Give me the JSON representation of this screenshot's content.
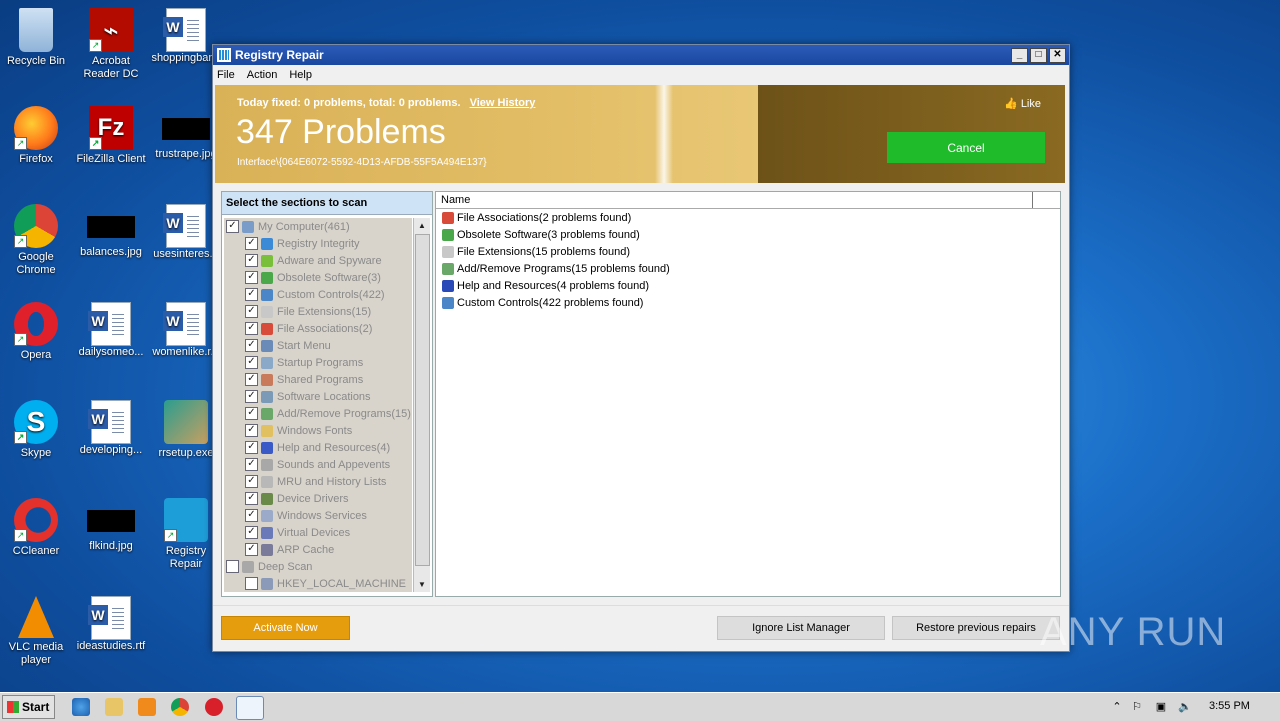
{
  "desktop": {
    "icons": [
      {
        "label": "Recycle Bin"
      },
      {
        "label": "Acrobat Reader DC"
      },
      {
        "label": "shoppingbar..."
      },
      {
        "label": "Firefox"
      },
      {
        "label": "FileZilla Client"
      },
      {
        "label": "trustrape.jpg"
      },
      {
        "label": "Google Chrome"
      },
      {
        "label": "balances.jpg"
      },
      {
        "label": "usesinteres..."
      },
      {
        "label": "Opera"
      },
      {
        "label": "dailysomeo..."
      },
      {
        "label": "womenlike.r..."
      },
      {
        "label": "Skype"
      },
      {
        "label": "developing..."
      },
      {
        "label": "rrsetup.exe"
      },
      {
        "label": "CCleaner"
      },
      {
        "label": "flkind.jpg"
      },
      {
        "label": "Registry Repair"
      },
      {
        "label": "VLC media player"
      },
      {
        "label": "ideastudies.rtf"
      }
    ]
  },
  "window": {
    "title": "Registry Repair",
    "menu": [
      "File",
      "Action",
      "Help"
    ],
    "banner": {
      "fixed_text": "Today fixed: 0 problems, total: 0 problems.",
      "view_history": "View History",
      "problems_count": "347 Problems",
      "interface_path": "Interface\\{064E6072-5592-4D13-AFDB-55F5A494E137}",
      "like": "Like",
      "cancel": "Cancel"
    },
    "left_panel": {
      "header": "Select the sections to scan",
      "tree": [
        {
          "label": "My Computer(461)",
          "level": 0,
          "checked": true,
          "icon": "computer-icon",
          "color": "#7a9cc8"
        },
        {
          "label": "Registry Integrity",
          "level": 1,
          "checked": true,
          "icon": "registry-icon",
          "color": "#3a8ad8"
        },
        {
          "label": "Adware and Spyware",
          "level": 1,
          "checked": true,
          "icon": "spyware-icon",
          "color": "#7abf3a"
        },
        {
          "label": "Obsolete Software(3)",
          "level": 1,
          "checked": true,
          "icon": "trash-icon",
          "color": "#4aa84a"
        },
        {
          "label": "Custom Controls(422)",
          "level": 1,
          "checked": true,
          "icon": "controls-icon",
          "color": "#4a86c8"
        },
        {
          "label": "File Extensions(15)",
          "level": 1,
          "checked": true,
          "icon": "file-icon",
          "color": "#c8c8c8"
        },
        {
          "label": "File Associations(2)",
          "level": 1,
          "checked": true,
          "icon": "association-icon",
          "color": "#d84a3a"
        },
        {
          "label": "Start Menu",
          "level": 1,
          "checked": true,
          "icon": "start-menu-icon",
          "color": "#6a8ab8"
        },
        {
          "label": "Startup Programs",
          "level": 1,
          "checked": true,
          "icon": "startup-icon",
          "color": "#8aa8c8"
        },
        {
          "label": "Shared Programs",
          "level": 1,
          "checked": true,
          "icon": "shared-icon",
          "color": "#c87a5a"
        },
        {
          "label": "Software Locations",
          "level": 1,
          "checked": true,
          "icon": "location-icon",
          "color": "#7a9ab8"
        },
        {
          "label": "Add/Remove Programs(15)",
          "level": 1,
          "checked": true,
          "icon": "add-remove-icon",
          "color": "#6aa86a"
        },
        {
          "label": "Windows Fonts",
          "level": 1,
          "checked": true,
          "icon": "fonts-icon",
          "color": "#e0c060"
        },
        {
          "label": "Help and Resources(4)",
          "level": 1,
          "checked": true,
          "icon": "help-icon",
          "color": "#3a5ac8"
        },
        {
          "label": "Sounds and Appevents",
          "level": 1,
          "checked": true,
          "icon": "sound-icon",
          "color": "#a8a8a8"
        },
        {
          "label": "MRU and History Lists",
          "level": 1,
          "checked": true,
          "icon": "history-icon",
          "color": "#b8b8b8"
        },
        {
          "label": "Device Drivers",
          "level": 1,
          "checked": true,
          "icon": "driver-icon",
          "color": "#6a8a4a"
        },
        {
          "label": "Windows Services",
          "level": 1,
          "checked": true,
          "icon": "services-icon",
          "color": "#9aaac8"
        },
        {
          "label": "Virtual Devices",
          "level": 1,
          "checked": true,
          "icon": "virtual-device-icon",
          "color": "#6a7ab8"
        },
        {
          "label": "ARP Cache",
          "level": 1,
          "checked": true,
          "icon": "network-icon",
          "color": "#7a7a9a"
        },
        {
          "label": "Deep Scan",
          "level": 0,
          "checked": false,
          "icon": "deep-scan-icon",
          "color": "#a8a8a8"
        },
        {
          "label": "HKEY_LOCAL_MACHINE",
          "level": 1,
          "checked": false,
          "icon": "hive-icon",
          "color": "#8a9ab8"
        }
      ]
    },
    "right_panel": {
      "column_header": "Name",
      "rows": [
        {
          "label": "File Associations(2 problems found)",
          "icon": "association-icon",
          "color": "#d84a3a"
        },
        {
          "label": "Obsolete Software(3 problems found)",
          "icon": "trash-icon",
          "color": "#4aa84a"
        },
        {
          "label": "File Extensions(15 problems found)",
          "icon": "file-icon",
          "color": "#c8c8c8"
        },
        {
          "label": "Add/Remove Programs(15 problems found)",
          "icon": "add-remove-icon",
          "color": "#6aa86a"
        },
        {
          "label": "Help and Resources(4 problems found)",
          "icon": "help-icon",
          "color": "#2a4ab8"
        },
        {
          "label": "Custom Controls(422 problems found)",
          "icon": "controls-icon",
          "color": "#4a86c8"
        }
      ]
    },
    "buttons": {
      "activate": "Activate Now",
      "ignore": "Ignore List Manager",
      "restore": "Restore previous repairs"
    }
  },
  "taskbar": {
    "start": "Start",
    "clock": "3:55 PM"
  },
  "watermark": "ANY RUN",
  "colors": {
    "accent": "#1fbb2a",
    "activate": "#e59d0d",
    "banner_gold": "#e2bd65",
    "banner_brown": "#7a5c1c"
  }
}
